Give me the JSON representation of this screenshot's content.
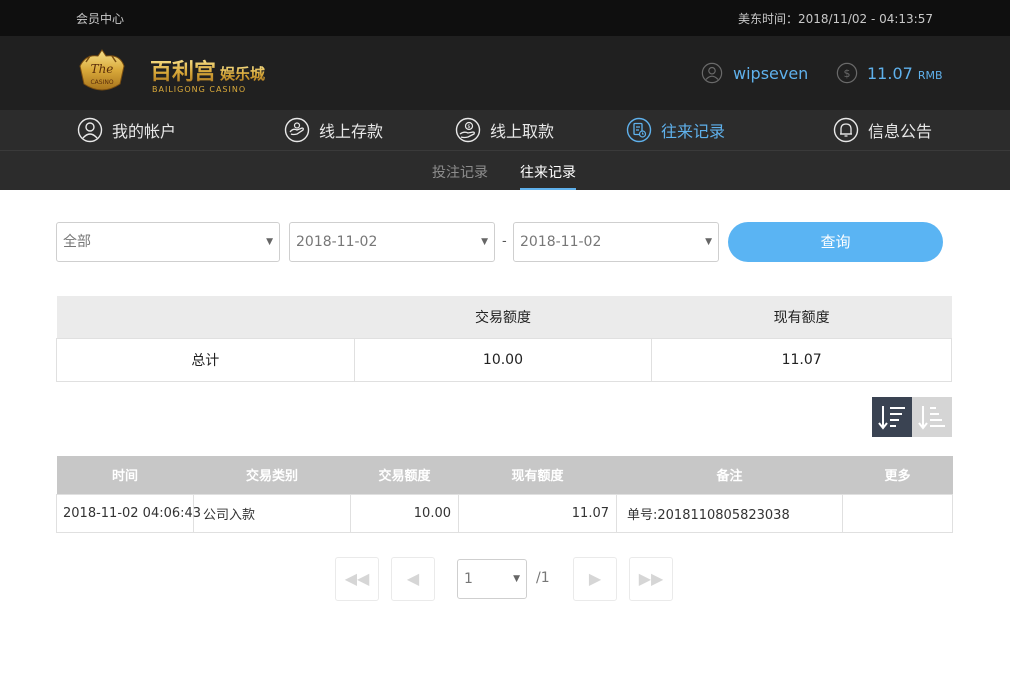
{
  "topbar": {
    "member_center": "会员中心",
    "time_label": "美东时间：2018/11/02 - 04:13:57"
  },
  "header": {
    "logo_cn": "百利宫",
    "logo_cn2": "娱乐城",
    "logo_en": "BAILIGONG CASINO",
    "logo_badge": "The",
    "logo_badge2": "CASINO",
    "username": "wipseven",
    "balance": "11.07",
    "currency": "RMB"
  },
  "nav": {
    "items": [
      {
        "label": "我的帐户",
        "icon": "user-circle-icon"
      },
      {
        "label": "线上存款",
        "icon": "deposit-hand-icon"
      },
      {
        "label": "线上取款",
        "icon": "withdraw-hand-icon"
      },
      {
        "label": "往来记录",
        "icon": "record-doc-icon"
      },
      {
        "label": "信息公告",
        "icon": "bell-icon"
      }
    ],
    "active_index": 3
  },
  "subnav": {
    "tabs": [
      "投注记录",
      "往来记录"
    ],
    "active_index": 1
  },
  "filters": {
    "type_value": "全部",
    "date_from": "2018-11-02",
    "dash": "-",
    "date_to": "2018-11-02",
    "query_label": "查询"
  },
  "summary": {
    "headers": [
      "",
      "交易额度",
      "现有额度"
    ],
    "row_label": "总计",
    "trade_amount": "10.00",
    "current_amount": "11.07"
  },
  "records": {
    "headers": [
      "时间",
      "交易类别",
      "交易额度",
      "现有额度",
      "备注",
      "更多"
    ],
    "rows": [
      {
        "time": "2018-11-02 04:06:43",
        "category": "公司入款",
        "amount": "10.00",
        "balance": "11.07",
        "note": "单号:201811080582303​8",
        "more": ""
      }
    ]
  },
  "pager": {
    "current": "1",
    "total": "/1"
  },
  "colors": {
    "accent": "#5fb1ec",
    "button": "#5ab4f3",
    "dark_bg": "#202020",
    "nav_bg": "#2c2c2c"
  }
}
